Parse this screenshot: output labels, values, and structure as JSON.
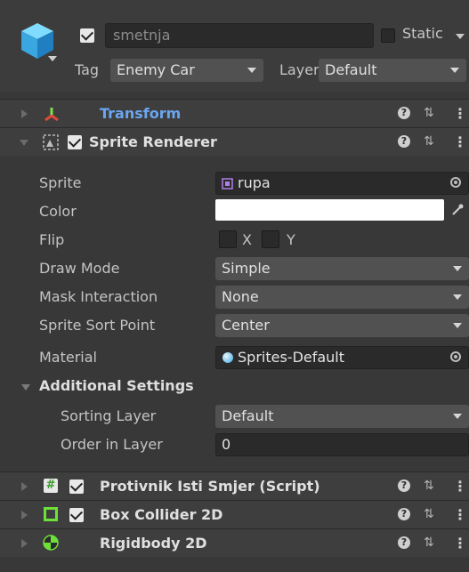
{
  "header": {
    "active": true,
    "name": "smetnja",
    "static_label": "Static",
    "static_checked": false,
    "tag_label": "Tag",
    "tag_value": "Enemy Car",
    "layer_label": "Layer",
    "layer_value": "Default",
    "cube_icon": "gameobject-cube-icon"
  },
  "components": {
    "transform": {
      "title": "Transform",
      "icon": "transform-axes-icon"
    },
    "sprite_renderer": {
      "title": "Sprite Renderer",
      "enabled": true,
      "icon": "sprite-renderer-icon"
    },
    "script": {
      "title": "Protivnik Isti Smjer (Script)",
      "enabled": true,
      "icon": "script-hash-icon"
    },
    "box_collider": {
      "title": "Box Collider 2D",
      "enabled": true,
      "icon": "box-collider-icon"
    },
    "rigidbody": {
      "title": "Rigidbody 2D",
      "icon": "rigidbody-icon"
    }
  },
  "sprite_renderer": {
    "sprite_label": "Sprite",
    "sprite_value": "rupa",
    "color_label": "Color",
    "color_value": "#ffffff",
    "flip_label": "Flip",
    "flip_x": "X",
    "flip_y": "Y",
    "draw_mode_label": "Draw Mode",
    "draw_mode_value": "Simple",
    "mask_label": "Mask Interaction",
    "mask_value": "None",
    "sort_point_label": "Sprite Sort Point",
    "sort_point_value": "Center",
    "material_label": "Material",
    "material_value": "Sprites-Default",
    "additional_label": "Additional Settings",
    "sorting_layer_label": "Sorting Layer",
    "sorting_layer_value": "Default",
    "order_label": "Order in Layer",
    "order_value": "0"
  },
  "colors": {
    "background": "#383838",
    "accent_blue": "#6aa6ef",
    "transform_red": "#e0483c",
    "collider_green": "#6ee03a"
  }
}
